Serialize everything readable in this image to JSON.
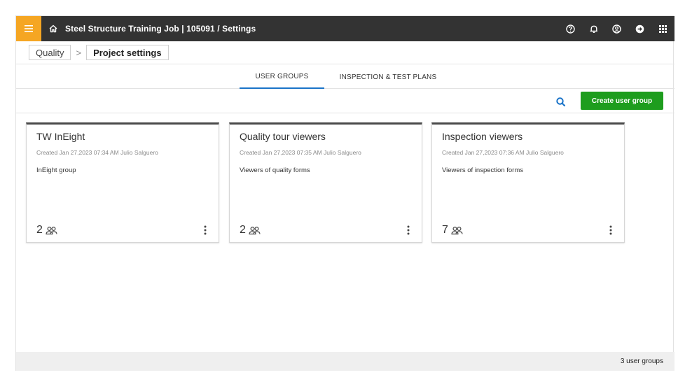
{
  "header": {
    "title": "Steel Structure Training Job | 105091  /  Settings",
    "icons": [
      "menu-icon",
      "home-icon",
      "help-icon",
      "bell-icon",
      "user-icon",
      "logout-icon",
      "apps-icon"
    ],
    "accent": "#f5a623",
    "bar_color": "#333333"
  },
  "breadcrumb": {
    "items": [
      "Quality",
      "Project settings"
    ]
  },
  "tabs": [
    {
      "label": "USER GROUPS",
      "active": true
    },
    {
      "label": "INSPECTION & TEST PLANS",
      "active": false
    }
  ],
  "toolbar": {
    "create_label": "Create user group",
    "create_color": "#1e9d1e"
  },
  "groups": [
    {
      "title": "TW InEight",
      "meta": "Created Jan 27,2023 07:34 AM Julio Salguero",
      "description": "InEight group",
      "count": "2"
    },
    {
      "title": "Quality tour viewers",
      "meta": "Created Jan 27,2023 07:35 AM Julio Salguero",
      "description": "Viewers of quality forms",
      "count": "2"
    },
    {
      "title": "Inspection viewers",
      "meta": "Created Jan 27,2023 07:36 AM Julio Salguero",
      "description": "Viewers of inspection forms",
      "count": "7"
    }
  ],
  "status": {
    "summary": "3 user groups"
  }
}
